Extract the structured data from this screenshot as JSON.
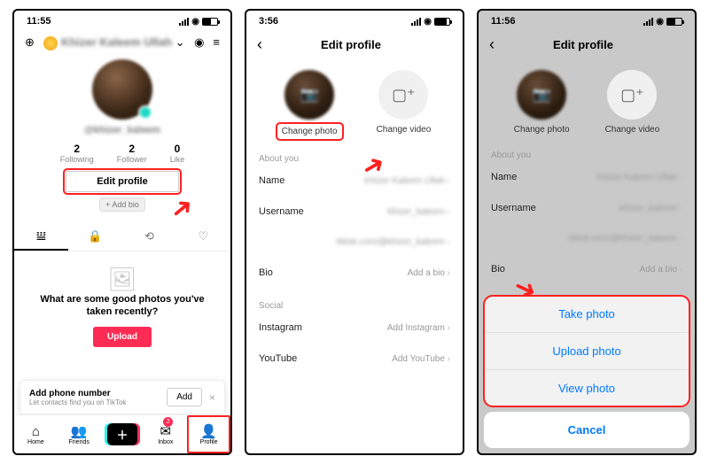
{
  "screen1": {
    "time": "11:55",
    "username": "Khizer Kaleem Ullah",
    "handle": "@khizer_kaleem",
    "stats": [
      {
        "n": "2",
        "l": "Following"
      },
      {
        "n": "2",
        "l": "Follower"
      },
      {
        "n": "0",
        "l": "Like"
      }
    ],
    "edit": "Edit profile",
    "addbio": "+ Add bio",
    "empty_title": "What are some good photos you've taken recently?",
    "upload": "Upload",
    "banner": {
      "title": "Add phone number",
      "sub": "Let contacts find you on TikTok",
      "btn": "Add"
    },
    "nav": [
      "Home",
      "Friends",
      "",
      "Inbox",
      "Profile"
    ],
    "inbox_badge": "2"
  },
  "screen2": {
    "time": "3:56",
    "title": "Edit profile",
    "batt": "79",
    "change_photo": "Change photo",
    "change_video": "Change video",
    "about": "About you",
    "rows": [
      {
        "k": "Name",
        "v": "Khizer Kaleem Ullah"
      },
      {
        "k": "Username",
        "v": "khizer_kaleem"
      },
      {
        "k": "",
        "v": "tiktok.com/@khizer_kaleem"
      },
      {
        "k": "Bio",
        "v": "Add a bio"
      }
    ],
    "social": "Social",
    "srows": [
      {
        "k": "Instagram",
        "v": "Add Instagram"
      },
      {
        "k": "YouTube",
        "v": "Add YouTube"
      }
    ]
  },
  "screen3": {
    "time": "11:56",
    "title": "Edit profile",
    "change_photo": "Change photo",
    "change_video": "Change video",
    "about": "About you",
    "rows": [
      {
        "k": "Name",
        "v": "Khizer Kaleem Ullah"
      },
      {
        "k": "Username",
        "v": "khizer_kaleem"
      },
      {
        "k": "",
        "v": "tiktok.com/@khizer_kaleem"
      },
      {
        "k": "Bio",
        "v": "Add a bio"
      }
    ],
    "sheet": [
      "Take photo",
      "Upload photo",
      "View photo"
    ],
    "cancel": "Cancel"
  }
}
